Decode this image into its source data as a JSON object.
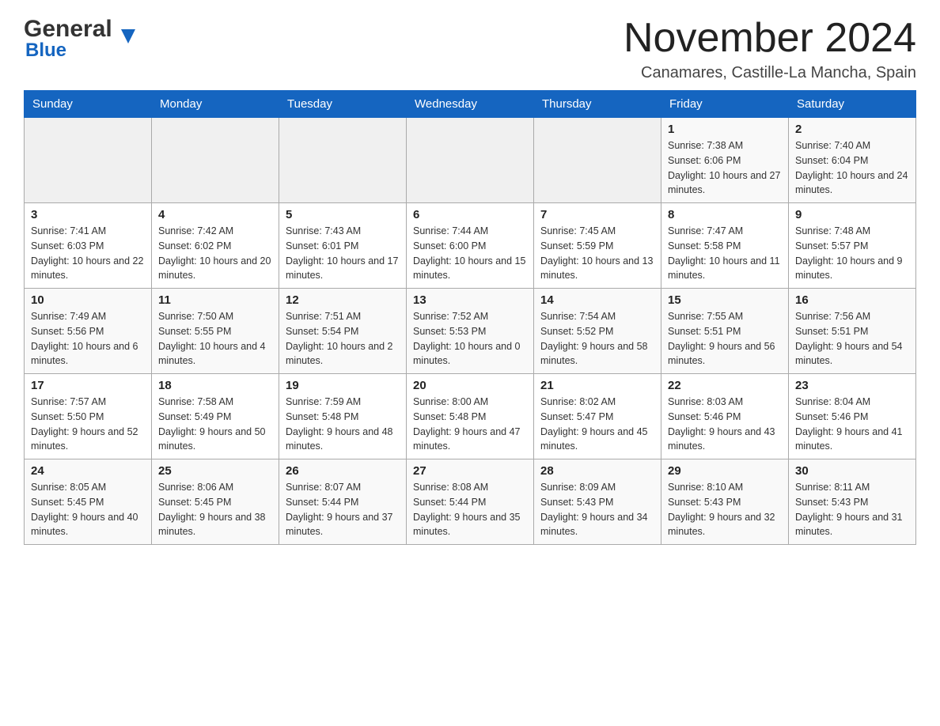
{
  "header": {
    "logo_general": "General",
    "logo_blue": "Blue",
    "main_title": "November 2024",
    "subtitle": "Canamares, Castille-La Mancha, Spain"
  },
  "weekdays": [
    "Sunday",
    "Monday",
    "Tuesday",
    "Wednesday",
    "Thursday",
    "Friday",
    "Saturday"
  ],
  "rows": [
    [
      {
        "day": "",
        "info": ""
      },
      {
        "day": "",
        "info": ""
      },
      {
        "day": "",
        "info": ""
      },
      {
        "day": "",
        "info": ""
      },
      {
        "day": "",
        "info": ""
      },
      {
        "day": "1",
        "info": "Sunrise: 7:38 AM\nSunset: 6:06 PM\nDaylight: 10 hours and 27 minutes."
      },
      {
        "day": "2",
        "info": "Sunrise: 7:40 AM\nSunset: 6:04 PM\nDaylight: 10 hours and 24 minutes."
      }
    ],
    [
      {
        "day": "3",
        "info": "Sunrise: 7:41 AM\nSunset: 6:03 PM\nDaylight: 10 hours and 22 minutes."
      },
      {
        "day": "4",
        "info": "Sunrise: 7:42 AM\nSunset: 6:02 PM\nDaylight: 10 hours and 20 minutes."
      },
      {
        "day": "5",
        "info": "Sunrise: 7:43 AM\nSunset: 6:01 PM\nDaylight: 10 hours and 17 minutes."
      },
      {
        "day": "6",
        "info": "Sunrise: 7:44 AM\nSunset: 6:00 PM\nDaylight: 10 hours and 15 minutes."
      },
      {
        "day": "7",
        "info": "Sunrise: 7:45 AM\nSunset: 5:59 PM\nDaylight: 10 hours and 13 minutes."
      },
      {
        "day": "8",
        "info": "Sunrise: 7:47 AM\nSunset: 5:58 PM\nDaylight: 10 hours and 11 minutes."
      },
      {
        "day": "9",
        "info": "Sunrise: 7:48 AM\nSunset: 5:57 PM\nDaylight: 10 hours and 9 minutes."
      }
    ],
    [
      {
        "day": "10",
        "info": "Sunrise: 7:49 AM\nSunset: 5:56 PM\nDaylight: 10 hours and 6 minutes."
      },
      {
        "day": "11",
        "info": "Sunrise: 7:50 AM\nSunset: 5:55 PM\nDaylight: 10 hours and 4 minutes."
      },
      {
        "day": "12",
        "info": "Sunrise: 7:51 AM\nSunset: 5:54 PM\nDaylight: 10 hours and 2 minutes."
      },
      {
        "day": "13",
        "info": "Sunrise: 7:52 AM\nSunset: 5:53 PM\nDaylight: 10 hours and 0 minutes."
      },
      {
        "day": "14",
        "info": "Sunrise: 7:54 AM\nSunset: 5:52 PM\nDaylight: 9 hours and 58 minutes."
      },
      {
        "day": "15",
        "info": "Sunrise: 7:55 AM\nSunset: 5:51 PM\nDaylight: 9 hours and 56 minutes."
      },
      {
        "day": "16",
        "info": "Sunrise: 7:56 AM\nSunset: 5:51 PM\nDaylight: 9 hours and 54 minutes."
      }
    ],
    [
      {
        "day": "17",
        "info": "Sunrise: 7:57 AM\nSunset: 5:50 PM\nDaylight: 9 hours and 52 minutes."
      },
      {
        "day": "18",
        "info": "Sunrise: 7:58 AM\nSunset: 5:49 PM\nDaylight: 9 hours and 50 minutes."
      },
      {
        "day": "19",
        "info": "Sunrise: 7:59 AM\nSunset: 5:48 PM\nDaylight: 9 hours and 48 minutes."
      },
      {
        "day": "20",
        "info": "Sunrise: 8:00 AM\nSunset: 5:48 PM\nDaylight: 9 hours and 47 minutes."
      },
      {
        "day": "21",
        "info": "Sunrise: 8:02 AM\nSunset: 5:47 PM\nDaylight: 9 hours and 45 minutes."
      },
      {
        "day": "22",
        "info": "Sunrise: 8:03 AM\nSunset: 5:46 PM\nDaylight: 9 hours and 43 minutes."
      },
      {
        "day": "23",
        "info": "Sunrise: 8:04 AM\nSunset: 5:46 PM\nDaylight: 9 hours and 41 minutes."
      }
    ],
    [
      {
        "day": "24",
        "info": "Sunrise: 8:05 AM\nSunset: 5:45 PM\nDaylight: 9 hours and 40 minutes."
      },
      {
        "day": "25",
        "info": "Sunrise: 8:06 AM\nSunset: 5:45 PM\nDaylight: 9 hours and 38 minutes."
      },
      {
        "day": "26",
        "info": "Sunrise: 8:07 AM\nSunset: 5:44 PM\nDaylight: 9 hours and 37 minutes."
      },
      {
        "day": "27",
        "info": "Sunrise: 8:08 AM\nSunset: 5:44 PM\nDaylight: 9 hours and 35 minutes."
      },
      {
        "day": "28",
        "info": "Sunrise: 8:09 AM\nSunset: 5:43 PM\nDaylight: 9 hours and 34 minutes."
      },
      {
        "day": "29",
        "info": "Sunrise: 8:10 AM\nSunset: 5:43 PM\nDaylight: 9 hours and 32 minutes."
      },
      {
        "day": "30",
        "info": "Sunrise: 8:11 AM\nSunset: 5:43 PM\nDaylight: 9 hours and 31 minutes."
      }
    ]
  ]
}
